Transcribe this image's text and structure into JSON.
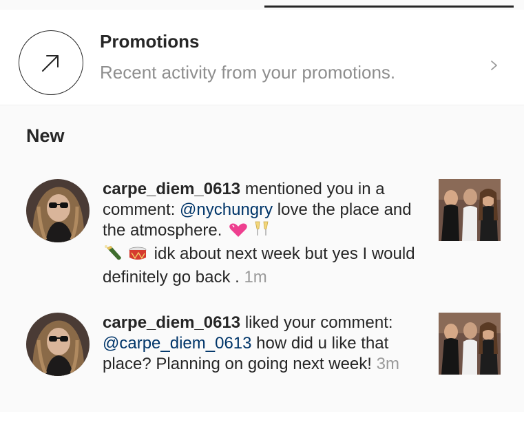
{
  "promotions": {
    "title": "Promotions",
    "subtitle": "Recent activity from your promotions.",
    "icon": "arrow-up-right-icon",
    "chevron": "chevron-right-icon"
  },
  "section": {
    "title": "New"
  },
  "notifications": [
    {
      "username": "carpe_diem_0613",
      "text_before": " mentioned you in a comment: ",
      "mention": "@nychungry",
      "text_after": " love the place and the atmosphere.",
      "emojis_line1": [
        "sparkling-heart",
        "champagne-glasses"
      ],
      "emojis_line2": [
        "champagne-bottle",
        "drum"
      ],
      "text_end": " idk about next week but yes I would definitely go back . ",
      "time": "1m"
    },
    {
      "username": "carpe_diem_0613",
      "text_before": " liked your comment: ",
      "mention": "@carpe_diem_0613",
      "text_after": " how did u like that place? Planning on going next week! ",
      "time": "3m"
    }
  ],
  "colors": {
    "background": "#fafafa",
    "text": "#262626",
    "secondary": "#8e8e8e",
    "mention": "#003569",
    "time": "#999999"
  }
}
